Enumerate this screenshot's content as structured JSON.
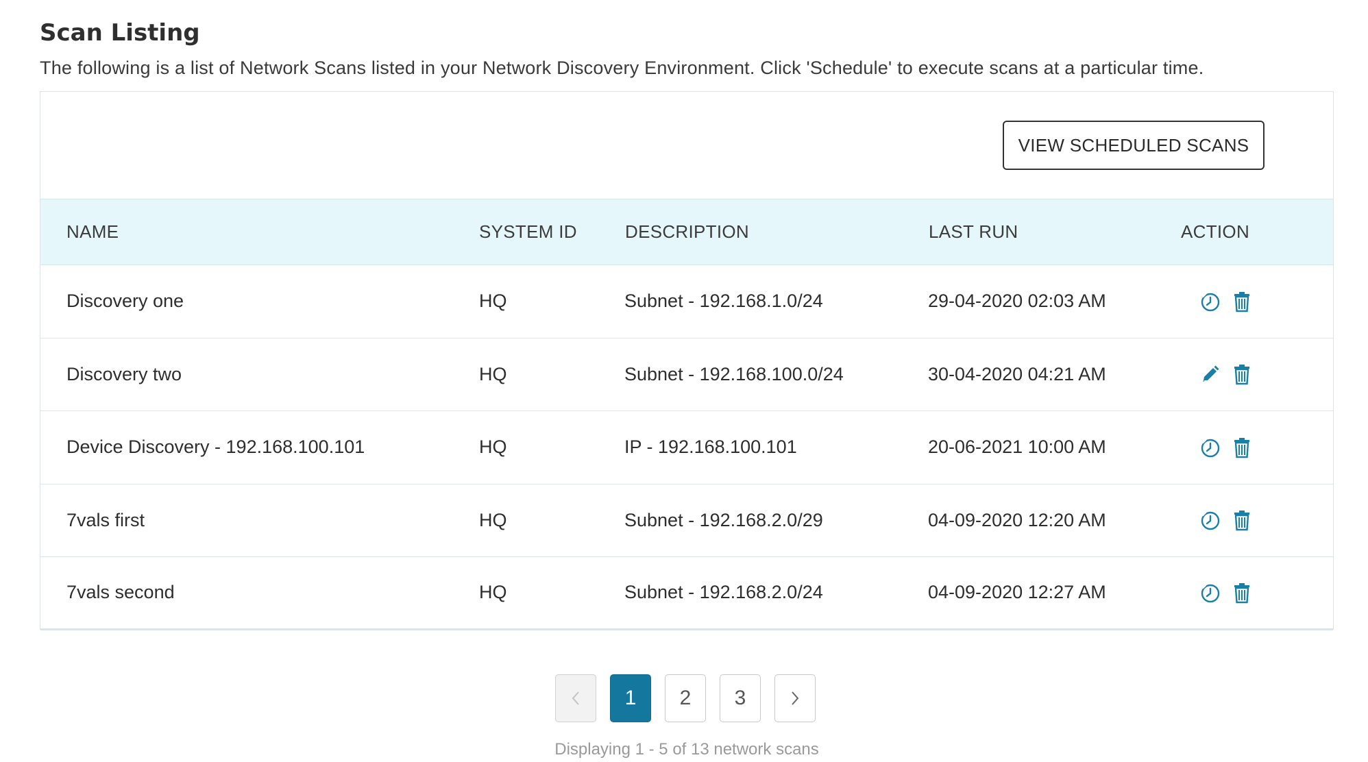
{
  "page": {
    "title": "Scan Listing",
    "description": "The following is a list of Network Scans listed in your Network Discovery Environment. Click 'Schedule' to execute scans at a particular time."
  },
  "toolbar": {
    "view_scheduled_label": "VIEW SCHEDULED SCANS"
  },
  "table": {
    "headers": {
      "name": "NAME",
      "system_id": "SYSTEM ID",
      "description": "DESCRIPTION",
      "last_run": "LAST RUN",
      "action": "ACTION"
    },
    "rows": [
      {
        "name": "Discovery one",
        "system_id": "HQ",
        "description": "Subnet - 192.168.1.0/24",
        "last_run": "29-04-2020 02:03 AM",
        "primary_action": "schedule-icon"
      },
      {
        "name": "Discovery two",
        "system_id": "HQ",
        "description": "Subnet - 192.168.100.0/24",
        "last_run": "30-04-2020 04:21 AM",
        "primary_action": "edit-icon"
      },
      {
        "name": "Device Discovery - 192.168.100.101",
        "system_id": "HQ",
        "description": "IP - 192.168.100.101",
        "last_run": "20-06-2021 10:00 AM",
        "primary_action": "schedule-icon"
      },
      {
        "name": "7vals first",
        "system_id": "HQ",
        "description": "Subnet - 192.168.2.0/29",
        "last_run": "04-09-2020 12:20 AM",
        "primary_action": "schedule-icon"
      },
      {
        "name": "7vals second",
        "system_id": "HQ",
        "description": "Subnet - 192.168.2.0/24",
        "last_run": "04-09-2020 12:27 AM",
        "primary_action": "schedule-icon"
      }
    ]
  },
  "pagination": {
    "pages": [
      "1",
      "2",
      "3"
    ],
    "current": "1",
    "summary": "Displaying 1 - 5 of 13 network scans"
  },
  "colors": {
    "accent": "#14789e",
    "header_bg": "#e6f7fb",
    "icon": "#1a7fa6"
  }
}
